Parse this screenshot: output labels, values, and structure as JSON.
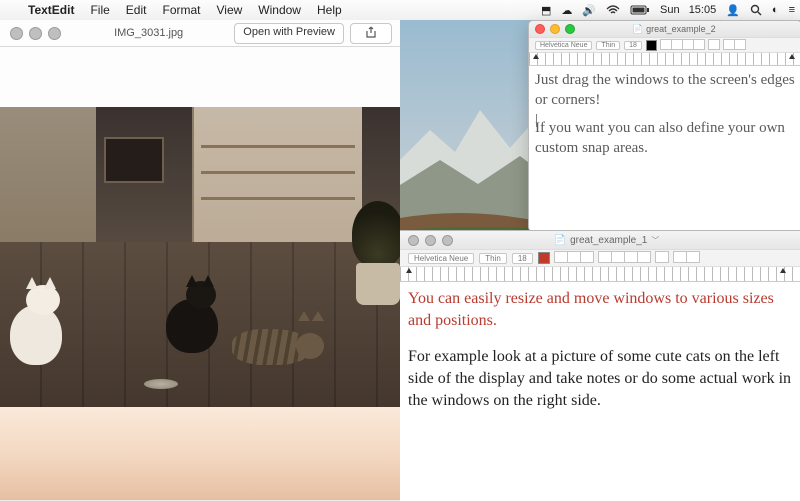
{
  "menubar": {
    "apple_icon": "apple",
    "app_name": "TextEdit",
    "items": [
      "File",
      "Edit",
      "Format",
      "View",
      "Window",
      "Help"
    ],
    "status": {
      "icons": [
        "dropbox",
        "cloud",
        "volume",
        "wifi",
        "battery"
      ],
      "day": "Sun",
      "time": "15:05",
      "trailing_icons": [
        "user",
        "search",
        "control-center",
        "notifications"
      ]
    }
  },
  "quicklook": {
    "filename": "IMG_3031.jpg",
    "open_button": "Open with Preview",
    "share_icon": "share"
  },
  "textedit_2": {
    "title": "great_example_2",
    "font_family": "Helvetica Neue",
    "font_style": "Thin",
    "font_size": "18",
    "paragraphs": [
      "Just drag the windows to the screen's edges or corners!",
      "If you want you can also define your own custom snap areas."
    ]
  },
  "textedit_1": {
    "title": "great_example_1",
    "font_family": "Helvetica Neue",
    "font_style": "Thin",
    "font_size": "18",
    "red_paragraph": "You can easily resize and move windows to various sizes and positions.",
    "black_paragraph": "For example look at a picture of some cute cats on the left side of the display and take notes or do some actual work in the windows on the right side."
  }
}
